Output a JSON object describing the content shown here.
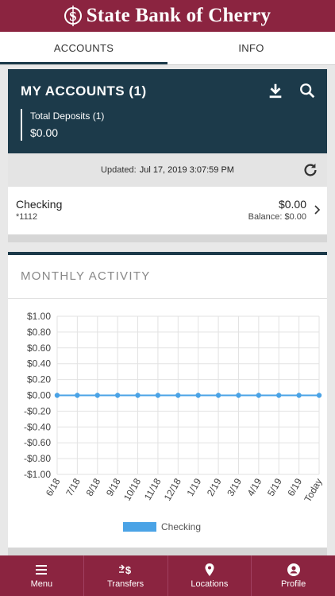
{
  "header": {
    "brand": "State Bank of Cherry"
  },
  "tabs": [
    {
      "label": "ACCOUNTS",
      "active": true
    },
    {
      "label": "INFO",
      "active": false
    }
  ],
  "my_accounts": {
    "title": "MY ACCOUNTS (1)",
    "deposits_label": "Total Deposits (1)",
    "deposits_value": "$0.00",
    "icons": [
      "download-icon",
      "search-icon"
    ]
  },
  "updated": {
    "prefix": "Updated:",
    "value": "Jul 17, 2019 3:07:59 PM"
  },
  "account": {
    "name": "Checking",
    "number": "*1112",
    "amount": "$0.00",
    "balance": "Balance: $0.00"
  },
  "activity": {
    "title": "MONTHLY ACTIVITY"
  },
  "chart_data": {
    "type": "line",
    "categories": [
      "6/18",
      "7/18",
      "8/18",
      "9/18",
      "10/18",
      "11/18",
      "12/18",
      "1/19",
      "2/19",
      "3/19",
      "4/19",
      "5/19",
      "6/19",
      "Today"
    ],
    "series": [
      {
        "name": "Checking",
        "values": [
          0,
          0,
          0,
          0,
          0,
          0,
          0,
          0,
          0,
          0,
          0,
          0,
          0,
          0
        ],
        "color": "#4aa3e6"
      }
    ],
    "y_ticks": [
      "$1.00",
      "$0.80",
      "$0.60",
      "$0.40",
      "$0.20",
      "$0.00",
      "-$0.20",
      "-$0.40",
      "-$0.60",
      "-$0.80",
      "-$1.00"
    ],
    "ylim": [
      -1,
      1
    ],
    "grid": true,
    "legend": "bottom-center"
  },
  "bottom_nav": [
    {
      "label": "Menu",
      "icon": "menu-icon"
    },
    {
      "label": "Transfers",
      "icon": "transfer-icon"
    },
    {
      "label": "Locations",
      "icon": "location-icon"
    },
    {
      "label": "Profile",
      "icon": "profile-icon"
    }
  ],
  "colors": {
    "brand": "#8b2440",
    "navy": "#1c3a4a",
    "series": "#4aa3e6"
  }
}
